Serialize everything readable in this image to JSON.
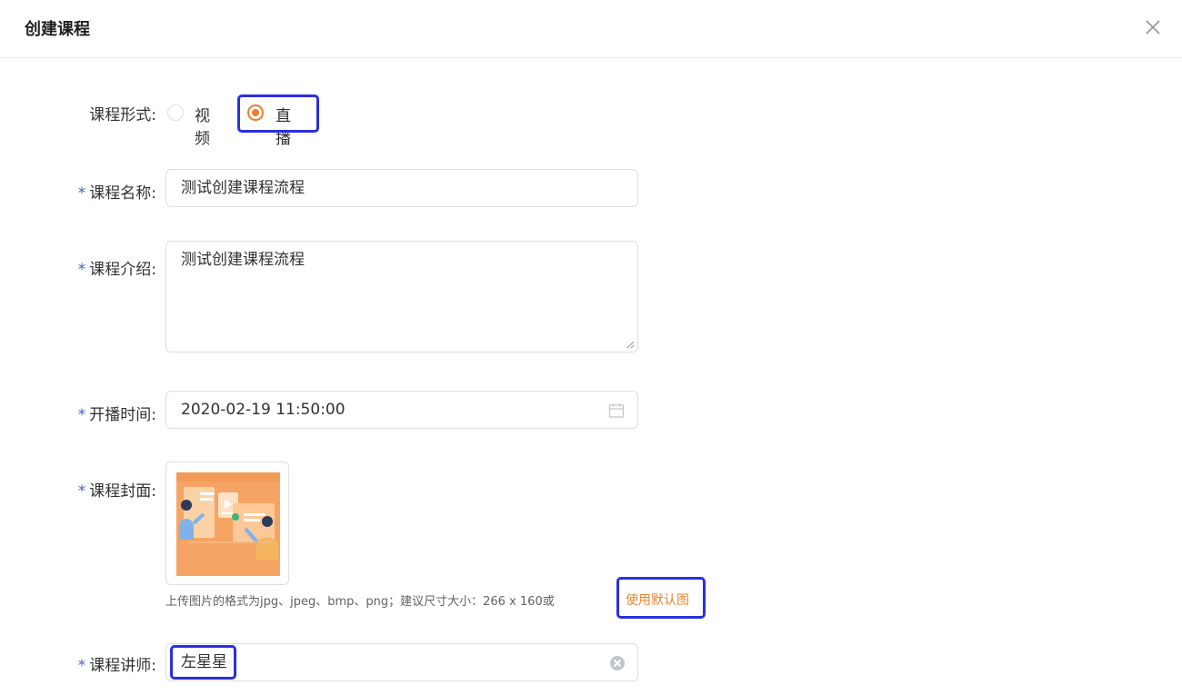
{
  "dialog": {
    "title": "创建课程",
    "close_icon": "close-icon"
  },
  "form": {
    "format": {
      "label": "课程形式:",
      "options": [
        "视频",
        "直播"
      ],
      "selected": "直播"
    },
    "name": {
      "label": "课程名称:",
      "value": "测试创建课程流程"
    },
    "intro": {
      "label": "课程介绍:",
      "value": "测试创建课程流程"
    },
    "start_time": {
      "label": "开播时间:",
      "value": "2020-02-19 11:50:00",
      "icon": "calendar-icon"
    },
    "cover": {
      "label": "课程封面:",
      "hint": "上传图片的格式为jpg、jpeg、bmp、png；建议尺寸大小：266 x 160或",
      "default_link": "使用默认图"
    },
    "lecturer": {
      "label": "课程讲师:",
      "value": "左星星",
      "icon": "clear-icon"
    },
    "required_mark": "*"
  },
  "colors": {
    "accent": "#f07c2a",
    "highlight": "#2b2ee0",
    "required": "#3a5fd9"
  }
}
